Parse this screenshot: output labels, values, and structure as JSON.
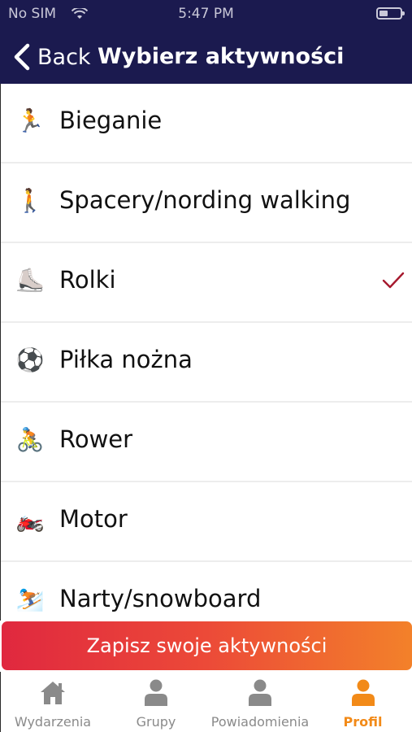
{
  "status_bar": {
    "carrier": "No SIM",
    "time": "5:47 PM"
  },
  "header": {
    "back_label": "Back",
    "title": "Wybierz aktywności",
    "background_color": "#1b1a4f"
  },
  "activities": [
    {
      "label": "Bieganie",
      "emoji": "🏃",
      "selected": false
    },
    {
      "label": "Spacery/nording walking",
      "emoji": "🚶",
      "selected": false
    },
    {
      "label": "Rolki",
      "emoji": "⛸️",
      "selected": true
    },
    {
      "label": "Piłka nożna",
      "emoji": "⚽",
      "selected": false
    },
    {
      "label": "Rower",
      "emoji": "🚴",
      "selected": false
    },
    {
      "label": "Motor",
      "emoji": "🏍️",
      "selected": false
    },
    {
      "label": "Narty/snowboard",
      "emoji": "⛷️",
      "selected": false
    }
  ],
  "check_color": "#a6192e",
  "save_button": {
    "label": "Zapisz swoje aktywności",
    "gradient_start": "#e0283f",
    "gradient_end": "#f3812a"
  },
  "tabbar": {
    "tabs": [
      {
        "label": "Wydarzenia",
        "icon": "home-icon",
        "active": false
      },
      {
        "label": "Grupy",
        "icon": "person-icon",
        "active": false
      },
      {
        "label": "Powiadomienia",
        "icon": "person-icon",
        "active": false
      },
      {
        "label": "Profil",
        "icon": "person-icon",
        "active": true
      }
    ],
    "active_color": "#f28a18",
    "inactive_color": "#8a8a8a"
  }
}
